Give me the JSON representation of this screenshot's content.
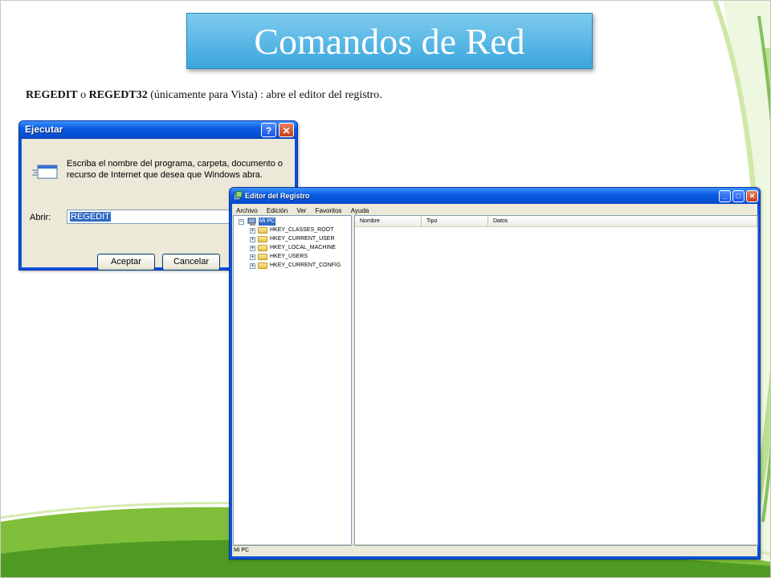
{
  "slide": {
    "title": "Comandos de Red",
    "desc_cmd1": "REGEDIT",
    "desc_or": "o",
    "desc_cmd2": "REGEDT32",
    "desc_rest": "(únicamente para Vista) : abre el editor del registro."
  },
  "run_dialog": {
    "title": "Ejecutar",
    "help_btn": "?",
    "close_btn": "✕",
    "prompt_line1": "Escriba el nombre del programa, carpeta, documento o",
    "prompt_line2": "recurso de Internet que desea que Windows abra.",
    "open_label": "Abrir:",
    "input_value": "REGEDIT",
    "ok_label": "Aceptar",
    "cancel_label": "Cancelar"
  },
  "regedit": {
    "title": "Editor del Registro",
    "menu": [
      "Archivo",
      "Edición",
      "Ver",
      "Favoritos",
      "Ayuda"
    ],
    "root": "Mi PC",
    "keys": [
      "HKEY_CLASSES_ROOT",
      "HKEY_CURRENT_USER",
      "HKEY_LOCAL_MACHINE",
      "HKEY_USERS",
      "HKEY_CURRENT_CONFIG"
    ],
    "columns": [
      "Nombre",
      "Tipo",
      "Datos"
    ],
    "status": "Mi PC",
    "collapse_sign": "−",
    "expand_sign": "+"
  },
  "colors": {
    "title_bar": "#0a5ae0",
    "title_box": "#3aa6dd",
    "accent_green": "#8dc63f"
  }
}
